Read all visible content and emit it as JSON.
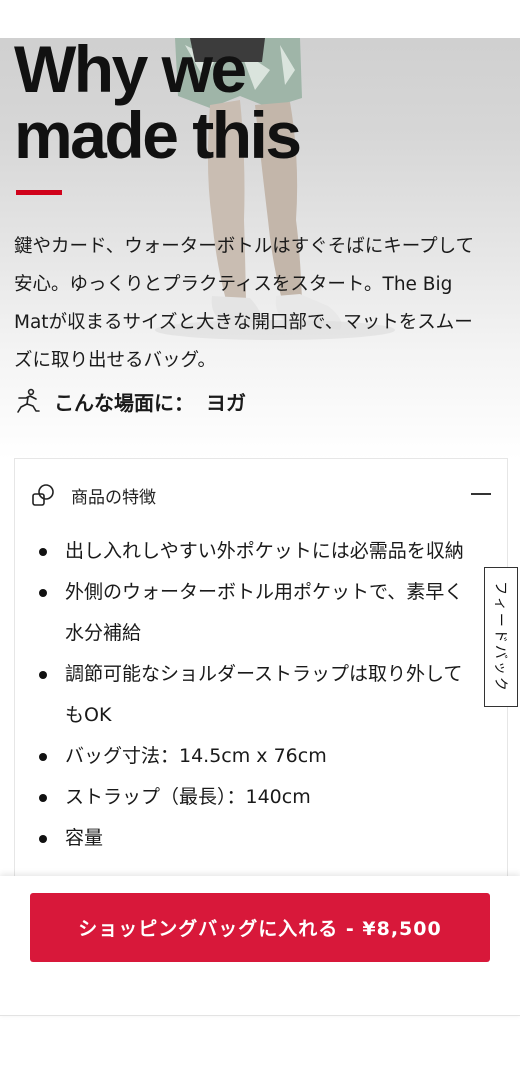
{
  "hero": {
    "headline": "Why we\nmade this",
    "description": "鍵やカード、ウォーターボトルはすぐそばにキープして安心。ゆっくりとプラクティスをスタート。The Big Matが収まるサイズと大きな開口部で、マットをスムーズに取り出せるバッグ。",
    "activity": {
      "icon": "yoga-pose-icon",
      "label": "こんな場面に：",
      "value": "ヨガ"
    },
    "accent_color": "#d0021b"
  },
  "features_panel": {
    "icon": "shapes-icon",
    "title": "商品の特徴",
    "collapse_icon": "minus-icon",
    "items": [
      "出し入れしやすい外ポケットには必需品を収納",
      "外側のウォーターボトル用ポケットで、素早く水分補給",
      "調節可能なショルダーストラップは取り外してもOK",
      "バッグ寸法：14.5cm x 76cm",
      "ストラップ（最長）：140cm",
      "容量"
    ]
  },
  "feedback": {
    "label": "フィードバック"
  },
  "cart": {
    "button_label": "ショッピングバッグに入れる - ¥8,500",
    "button_color": "#d8183a"
  }
}
